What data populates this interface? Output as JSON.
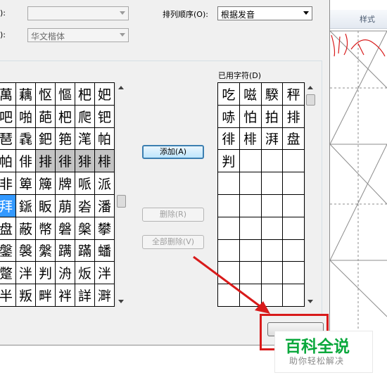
{
  "top_form": {
    "row1_label_fragment": "):",
    "row1_value": "",
    "row2_label_fragment": "):",
    "row2_value": "华文楷体",
    "sort_label": "排列顺序(O):",
    "sort_value": "根据发音"
  },
  "candidate_grid": {
    "rows": [
      [
        "萬",
        "藕",
        "怄",
        "慪",
        "杷",
        "妑"
      ],
      [
        "吧",
        "啪",
        "葩",
        "杷",
        "爬",
        "钯"
      ],
      [
        "琶",
        "毳",
        "鈀",
        "筢",
        "滗",
        "帕"
      ],
      [
        "帕",
        "俳",
        "排",
        "徘",
        "猅",
        "棑"
      ],
      [
        "非",
        "箄",
        "簰",
        "牌",
        "哌",
        "派"
      ],
      [
        "拜",
        "鎃",
        "眅",
        "萠",
        "沯",
        "潘"
      ],
      [
        "盘",
        "蔽",
        "幣",
        "磐",
        "槃",
        "攀"
      ],
      [
        "鎜",
        "褩",
        "縏",
        "蹒",
        "蹣",
        "蟠"
      ],
      [
        "蹩",
        "泮",
        "判",
        "洀",
        "炍",
        "泮"
      ],
      [
        "半",
        "叛",
        "畔",
        "袢",
        "詳",
        "溿"
      ]
    ],
    "highlighted_row": 3,
    "highlighted_cols": [
      2,
      3,
      4,
      5
    ],
    "selected_cell": {
      "row": 5,
      "col": 0
    }
  },
  "used_chars": {
    "label": "已用字符(D)",
    "rows": [
      [
        "吃",
        "嗞",
        "騤",
        "秤"
      ],
      [
        "哧",
        "怕",
        "拍",
        "排"
      ],
      [
        "徘",
        "棑",
        "湃",
        "盘"
      ],
      [
        "判",
        "",
        "",
        ""
      ],
      [
        "",
        "",
        "",
        ""
      ],
      [
        "",
        "",
        "",
        ""
      ],
      [
        "",
        "",
        "",
        ""
      ],
      [
        "",
        "",
        "",
        ""
      ],
      [
        "",
        "",
        "",
        ""
      ],
      [
        "",
        "",
        "",
        ""
      ]
    ]
  },
  "buttons": {
    "add": "添加(A)",
    "delete": "删除(R)",
    "delete_all": "全部删除(V)"
  },
  "preview": {
    "tab_label": "样式"
  },
  "watermark": {
    "title": "百科全说",
    "subtitle": "助你轻松解决"
  },
  "colors": {
    "annotation_red": "#d81a1a",
    "selected_blue": "#3399ff",
    "watermark_green": "#0aa83c"
  }
}
